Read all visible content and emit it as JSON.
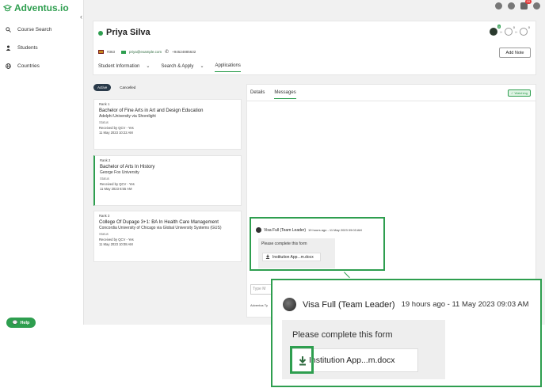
{
  "brand": {
    "name": "Adventus.io",
    "color": "#2e9e4f"
  },
  "sidebar": {
    "collapse_icon": "chevron-left-icon",
    "items": [
      {
        "label": "Course Search",
        "icon": "search-icon"
      },
      {
        "label": "Students",
        "icon": "person-icon"
      },
      {
        "label": "Countries",
        "icon": "globe-icon"
      }
    ],
    "help_label": "Help"
  },
  "topbar": {
    "notification_count": "10"
  },
  "student": {
    "name": "Priya Silva",
    "id": "#363",
    "email": "priya@example.com",
    "phone": "+94524885632",
    "add_note_label": "Add Note",
    "flow_counts": [
      "0",
      "0",
      "0"
    ],
    "tabs": [
      {
        "label": "Student Information"
      },
      {
        "label": "Search & Apply"
      },
      {
        "label": "Applications"
      }
    ]
  },
  "applications": {
    "filters": [
      "Active",
      "Cancelled"
    ],
    "cards": [
      {
        "rank": "Rank 1",
        "title": "Bachelor of Fine Arts in Art and Design Education",
        "university": "Adelphi University via Shorelight",
        "status_label": "Status",
        "status": "Received by QCV - Yes",
        "date": "11 May 2023 10:22 AM"
      },
      {
        "rank": "Rank 2",
        "title": "Bachelor of Arts In History",
        "university": "George Fox University",
        "status_label": "Status",
        "status": "Received by QCV - Yes",
        "date": "11 May 2023 6:55 AM"
      },
      {
        "rank": "Rank 3",
        "title": "College Of Dupage 3+1: BA In Health Care Management",
        "university": "Concordia University of Chicago via Global University Systems (GUS)",
        "status_label": "Status",
        "status": "Received by QCV - Yes",
        "date": "11 May 2023 10:08 AM"
      }
    ]
  },
  "panel": {
    "tabs": [
      "Details",
      "Messages"
    ],
    "watching_label": "Watching",
    "input_placeholder": "Type M",
    "footer_text": "Adventus Ty"
  },
  "message": {
    "sender": "Visa Full (Team Leader)",
    "meta": "19 hours ago - 11 May 2023 09:03 AM",
    "text": "Please complete this form",
    "attachment": "Institution App...m.docx"
  }
}
